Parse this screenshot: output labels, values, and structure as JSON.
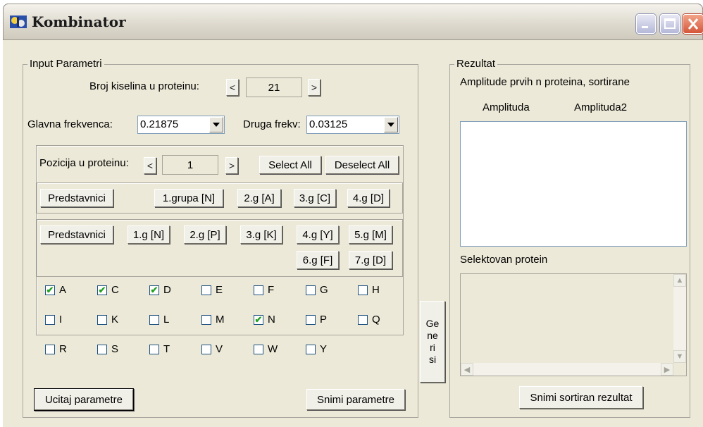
{
  "window": {
    "title": "Kombinator",
    "minimize_icon": "minimize-icon",
    "maximize_icon": "maximize-icon",
    "close_icon": "close-icon"
  },
  "input": {
    "group_label": "Input Parametri",
    "acid_count_label": "Broj kiselina u proteinu:",
    "acid_count_value": "21",
    "spin_left": "<",
    "spin_right": ">",
    "main_freq_label": "Glavna frekvenca:",
    "main_freq_value": "0.21875",
    "second_freq_label": "Druga frekv:",
    "second_freq_value": "0.03125",
    "position_label": "Pozicija u proteinu:",
    "position_value": "1",
    "select_all": "Select All",
    "deselect_all": "Deselect All",
    "row1": [
      "Predstavnici",
      "1.grupa [N]",
      "2.g [A]",
      "3.g [C]",
      "4.g [D]"
    ],
    "row2": [
      "Predstavnici",
      "1.g [N]",
      "2.g [P]",
      "3.g [K]",
      "4.g [Y]",
      "5.g [M]"
    ],
    "row3": [
      "6.g [F]",
      "7.g [D]"
    ],
    "checkboxes": [
      {
        "label": "A",
        "checked": true
      },
      {
        "label": "C",
        "checked": true
      },
      {
        "label": "D",
        "checked": true
      },
      {
        "label": "E",
        "checked": false
      },
      {
        "label": "F",
        "checked": false
      },
      {
        "label": "G",
        "checked": false
      },
      {
        "label": "H",
        "checked": false
      },
      {
        "label": "I",
        "checked": false
      },
      {
        "label": "K",
        "checked": false
      },
      {
        "label": "L",
        "checked": false
      },
      {
        "label": "M",
        "checked": false
      },
      {
        "label": "N",
        "checked": true
      },
      {
        "label": "P",
        "checked": false
      },
      {
        "label": "Q",
        "checked": false
      },
      {
        "label": "R",
        "checked": false
      },
      {
        "label": "S",
        "checked": false
      },
      {
        "label": "T",
        "checked": false
      },
      {
        "label": "V",
        "checked": false
      },
      {
        "label": "W",
        "checked": false
      },
      {
        "label": "Y",
        "checked": false
      }
    ],
    "load_button": "Ucitaj parametre",
    "save_button": "Snimi parametre"
  },
  "generate_button": [
    "Ge",
    "ne",
    "ri",
    "si"
  ],
  "result": {
    "group_label": "Rezultat",
    "heading": "Amplitude prvih n proteina, sortirane",
    "col1": "Amplituda",
    "col2": "Amplituda2",
    "selected_label": "Selektovan protein",
    "save_button": "Snimi sortiran rezultat"
  }
}
